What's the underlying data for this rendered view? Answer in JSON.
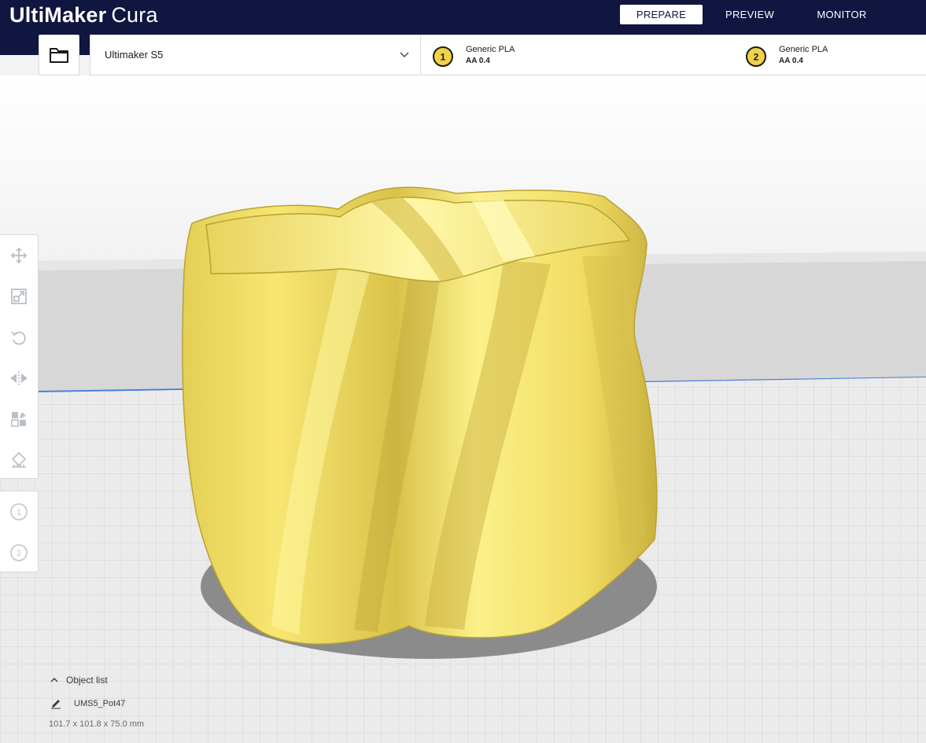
{
  "app": {
    "brand": "UltiMaker",
    "product": "Cura"
  },
  "stages": {
    "prepare": "PREPARE",
    "preview": "PREVIEW",
    "monitor": "MONITOR",
    "active": "prepare"
  },
  "printer": {
    "name": "Ultimaker S5"
  },
  "extruders": [
    {
      "number": "1",
      "material": "Generic PLA",
      "core": "AA 0.4"
    },
    {
      "number": "2",
      "material": "Generic PLA",
      "core": "AA 0.4"
    }
  ],
  "tools": [
    {
      "name": "move-tool",
      "icon": "move-icon"
    },
    {
      "name": "scale-tool",
      "icon": "scale-icon"
    },
    {
      "name": "rotate-tool",
      "icon": "rotate-icon"
    },
    {
      "name": "mirror-tool",
      "icon": "mirror-icon"
    },
    {
      "name": "per-model-settings-tool",
      "icon": "per-model-settings-icon"
    },
    {
      "name": "support-blocker-tool",
      "icon": "support-blocker-icon"
    }
  ],
  "object_list": {
    "label": "Object list",
    "object_name": "UMS5_Pot47",
    "dimensions": "101.7 x 101.8 x 75.0 mm"
  },
  "colors": {
    "header": "#10163f",
    "model": "#f5e26a",
    "badge": "#f0d24a"
  }
}
